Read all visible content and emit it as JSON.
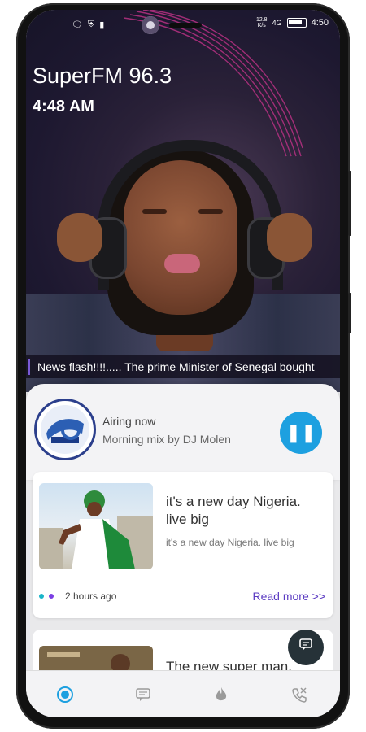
{
  "status_bar": {
    "network_label": "4G",
    "network_speed": "12.8\nK/s",
    "time": "4:50"
  },
  "hero": {
    "station_name": "SuperFM 96.3",
    "clock": "4:48 AM",
    "ticker": "News flash!!!!..... The prime Minister of Senegal bought"
  },
  "airing": {
    "label": "Airing now",
    "show": "Morning mix by DJ Molen"
  },
  "news": [
    {
      "title": "it's a new day Nigeria. live big",
      "snippet": "it's a new day Nigeria. live big",
      "time_ago": "2 hours ago",
      "read_more": "Read more >>"
    },
    {
      "title": "The new super man."
    }
  ],
  "colors": {
    "accent": "#1da0e0",
    "read_more": "#5b3bc2",
    "dot_teal": "#19b5c9",
    "dot_purple": "#7b3fe4"
  },
  "nav": [
    {
      "icon": "radio-icon"
    },
    {
      "icon": "chat-icon"
    },
    {
      "icon": "flame-icon"
    },
    {
      "icon": "phone-call-icon"
    }
  ]
}
